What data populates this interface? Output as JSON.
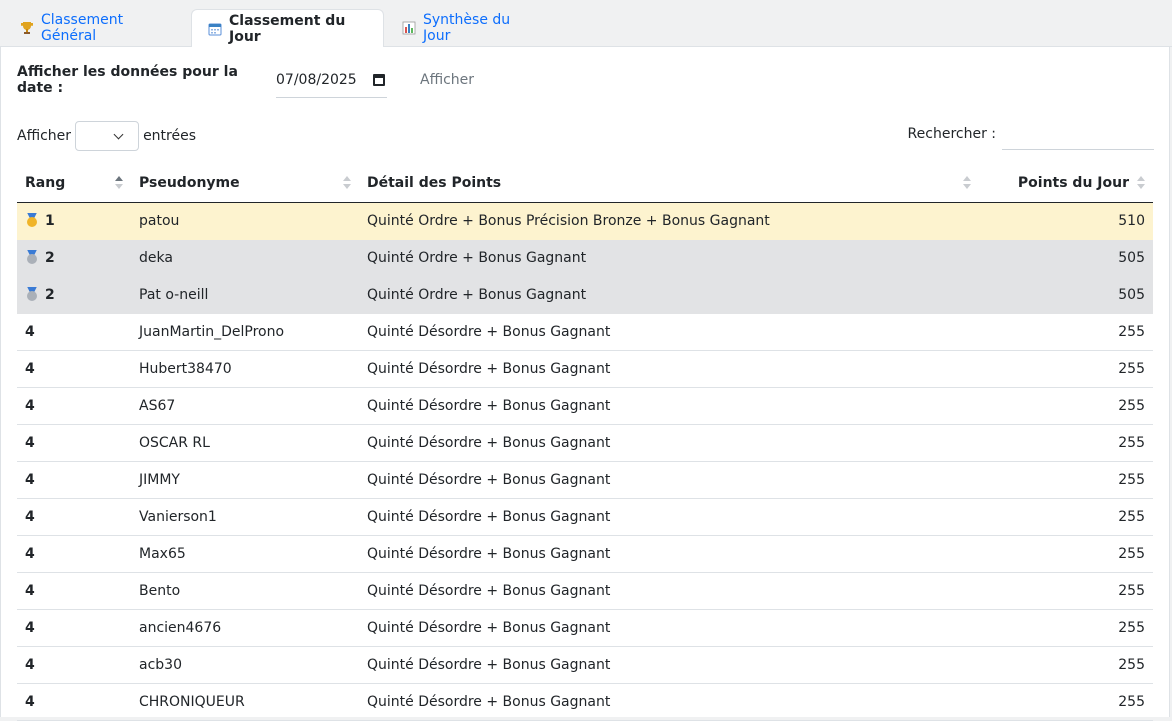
{
  "tabs": [
    {
      "label": "Classement Général",
      "icon": "trophy-icon"
    },
    {
      "label": "Classement du Jour",
      "icon": "calendar-icon"
    },
    {
      "label": "Synthèse du Jour",
      "icon": "bar-chart-icon"
    }
  ],
  "date_filter": {
    "label": "Afficher les données pour la date :",
    "value": "07/08/2025",
    "button": "Afficher"
  },
  "length": {
    "prefix": "Afficher",
    "suffix": "entrées",
    "value": ""
  },
  "search": {
    "label": "Rechercher :",
    "value": ""
  },
  "table": {
    "headers": [
      "Rang",
      "Pseudonyme",
      "Détail des Points",
      "Points du Jour"
    ],
    "rows": [
      {
        "rank": "1",
        "medal": "gold",
        "name": "patou",
        "detail": "Quinté Ordre + Bonus Précision Bronze + Bonus Gagnant",
        "points": "510"
      },
      {
        "rank": "2",
        "medal": "silver",
        "name": "deka",
        "detail": "Quinté Ordre + Bonus Gagnant",
        "points": "505"
      },
      {
        "rank": "2",
        "medal": "silver",
        "name": "Pat o-neill",
        "detail": "Quinté Ordre + Bonus Gagnant",
        "points": "505"
      },
      {
        "rank": "4",
        "medal": "",
        "name": "JuanMartin_DelProno",
        "detail": "Quinté Désordre + Bonus Gagnant",
        "points": "255"
      },
      {
        "rank": "4",
        "medal": "",
        "name": "Hubert38470",
        "detail": "Quinté Désordre + Bonus Gagnant",
        "points": "255"
      },
      {
        "rank": "4",
        "medal": "",
        "name": "AS67",
        "detail": "Quinté Désordre + Bonus Gagnant",
        "points": "255"
      },
      {
        "rank": "4",
        "medal": "",
        "name": "OSCAR RL",
        "detail": "Quinté Désordre + Bonus Gagnant",
        "points": "255"
      },
      {
        "rank": "4",
        "medal": "",
        "name": "JIMMY",
        "detail": "Quinté Désordre + Bonus Gagnant",
        "points": "255"
      },
      {
        "rank": "4",
        "medal": "",
        "name": "Vanierson1",
        "detail": "Quinté Désordre + Bonus Gagnant",
        "points": "255"
      },
      {
        "rank": "4",
        "medal": "",
        "name": "Max65",
        "detail": "Quinté Désordre + Bonus Gagnant",
        "points": "255"
      },
      {
        "rank": "4",
        "medal": "",
        "name": "Bento",
        "detail": "Quinté Désordre + Bonus Gagnant",
        "points": "255"
      },
      {
        "rank": "4",
        "medal": "",
        "name": "ancien4676",
        "detail": "Quinté Désordre + Bonus Gagnant",
        "points": "255"
      },
      {
        "rank": "4",
        "medal": "",
        "name": "acb30",
        "detail": "Quinté Désordre + Bonus Gagnant",
        "points": "255"
      },
      {
        "rank": "4",
        "medal": "",
        "name": "CHRONIQUEUR",
        "detail": "Quinté Désordre + Bonus Gagnant",
        "points": "255"
      }
    ]
  },
  "colors": {
    "link": "#0d6efd",
    "gold_row": "#fdf3cf",
    "silver_row": "#e2e3e5",
    "gold_medal": "#f0b429",
    "silver_medal": "#aab0b8"
  }
}
